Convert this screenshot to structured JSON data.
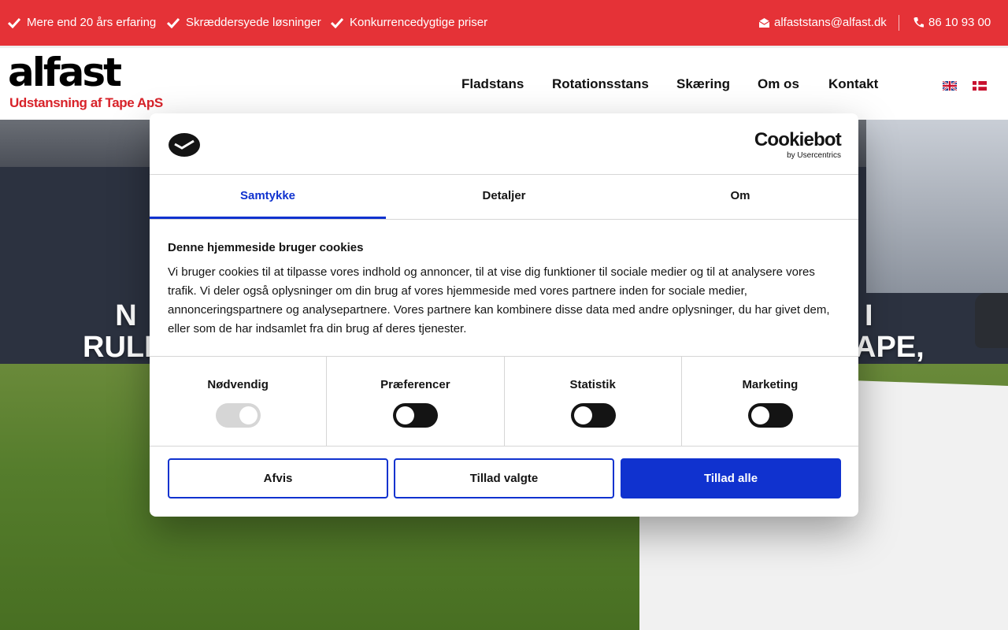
{
  "topbar": {
    "usps": [
      "Mere end 20 års erfaring",
      "Skræddersyede løsninger",
      "Konkurrencedygtige priser"
    ],
    "email": "alfaststans@alfast.dk",
    "phone": "86 10 93 00",
    "icons": [
      "check-icon",
      "envelope-icon",
      "phone-icon"
    ],
    "bg_color": "#e53237"
  },
  "header": {
    "logo_word": "alfast",
    "logo_tagline": "Udstansning af Tape ApS",
    "nav": [
      "Fladstans",
      "Rotationsstans",
      "Skæring",
      "Om os",
      "Kontakt"
    ],
    "languages": [
      "English",
      "Dansk"
    ]
  },
  "hero": {
    "line1_left": "N",
    "line1_right": "I",
    "line2_left": "RULL",
    "line2_right": "APE,"
  },
  "cookie": {
    "brand": "Cookiebot",
    "brand_by": "by Usercentrics",
    "tabs": [
      "Samtykke",
      "Detaljer",
      "Om"
    ],
    "active_tab": "Samtykke",
    "heading": "Denne hjemmeside bruger cookies",
    "body": "Vi bruger cookies til at tilpasse vores indhold og annoncer, til at vise dig funktioner til sociale medier og til at analysere vores trafik. Vi deler også oplysninger om din brug af vores hjemmeside med vores partnere inden for sociale medier, annonceringspartnere og analysepartnere. Vores partnere kan kombinere disse data med andre oplysninger, du har givet dem, eller som de har indsamlet fra din brug af deres tjenester.",
    "categories": [
      {
        "label": "Nødvendig",
        "enabled": true,
        "locked": true
      },
      {
        "label": "Præferencer",
        "enabled": false,
        "locked": false
      },
      {
        "label": "Statistik",
        "enabled": false,
        "locked": false
      },
      {
        "label": "Marketing",
        "enabled": false,
        "locked": false
      }
    ],
    "buttons": {
      "reject": "Afvis",
      "allow_selected": "Tillad valgte",
      "allow_all": "Tillad alle"
    },
    "accent_color": "#1032cf"
  }
}
